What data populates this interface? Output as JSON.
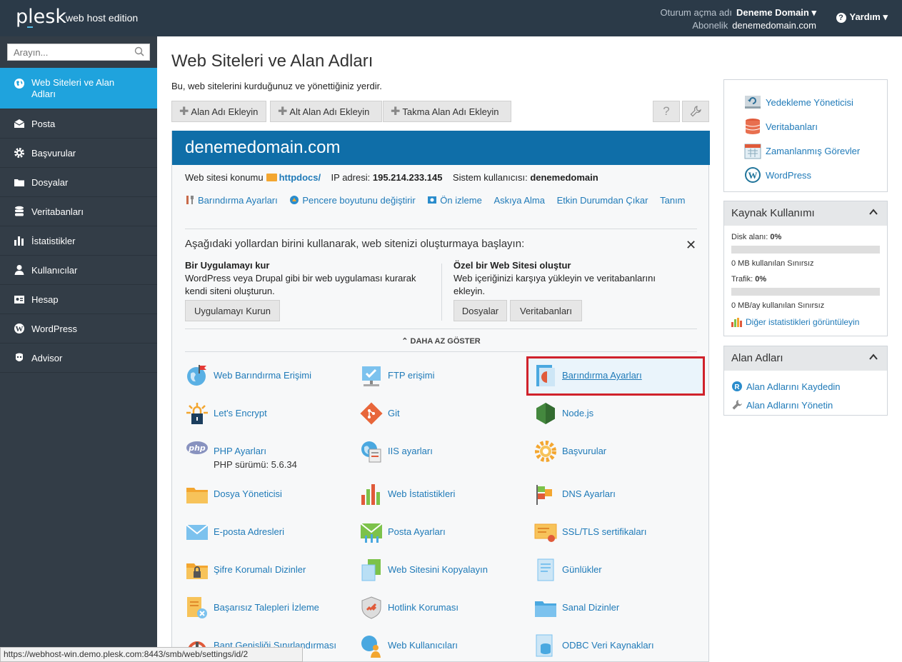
{
  "header": {
    "logo": "plesk",
    "edition": "web host edition",
    "login_label": "Oturum açma adı",
    "login_value": "Deneme Domain",
    "subscription_label": "Abonelik",
    "subscription_value": "denemedomain.com",
    "help": "Yardım"
  },
  "sidebar": {
    "search_placeholder": "Arayın...",
    "items": [
      {
        "label": "Web Siteleri ve Alan Adları",
        "icon": "globe-icon"
      },
      {
        "label": "Posta",
        "icon": "mail-icon"
      },
      {
        "label": "Başvurular",
        "icon": "gear-icon"
      },
      {
        "label": "Dosyalar",
        "icon": "folder-icon"
      },
      {
        "label": "Veritabanları",
        "icon": "database-icon"
      },
      {
        "label": "İstatistikler",
        "icon": "bar-chart-icon"
      },
      {
        "label": "Kullanıcılar",
        "icon": "user-icon"
      },
      {
        "label": "Hesap",
        "icon": "account-icon"
      },
      {
        "label": "WordPress",
        "icon": "wordpress-icon"
      },
      {
        "label": "Advisor",
        "icon": "advisor-icon"
      }
    ]
  },
  "main": {
    "title": "Web Siteleri ve Alan Adları",
    "description": "Bu, web sitelerini kurduğunuz ve yönettiğiniz yerdir.",
    "toolbar": {
      "add_domain": "Alan Adı Ekleyin",
      "add_subdomain": "Alt Alan Adı Ekleyin",
      "add_alias": "Takma Alan Adı Ekleyin"
    },
    "domain": {
      "name": "denemedomain.com",
      "location_label": "Web sitesi konumu",
      "location_value": "httpdocs/",
      "ip_label": "IP adresi:",
      "ip_value": "195.214.233.145",
      "sysuser_label": "Sistem kullanıcısı:",
      "sysuser_value": "denemedomain",
      "actions": [
        "Barındırma Ayarları",
        "Pencere boyutunu değiştirir",
        "Ön izleme",
        "Askıya Alma",
        "Etkin Durumdan Çıkar",
        "Tanım"
      ]
    },
    "start": {
      "title": "Aşağıdaki yollardan birini kullanarak, web sitenizi oluşturmaya başlayın:",
      "left_heading": "Bir Uygulamayı kur",
      "left_text_1": "WordPress veya Drupal gibi bir web uygulaması kurarak",
      "left_text_2": "kendi siteni oluşturun.",
      "left_button": "Uygulamayı Kurun",
      "right_heading": "Özel bir Web Sitesi oluştur",
      "right_text_1": "Web içeriğinizi karşıya yükleyin ve veritabanlarını",
      "right_text_2": "ekleyin.",
      "files_button": "Dosyalar",
      "db_button": "Veritabanları",
      "show_less": "DAHA AZ GÖSTER"
    },
    "tools": [
      {
        "label": "Web Barındırma Erişimi",
        "icon": "web-hosting-access-icon"
      },
      {
        "label": "FTP erişimi",
        "icon": "ftp-icon"
      },
      {
        "label": "Barındırma Ayarları",
        "icon": "hosting-settings-icon"
      },
      {
        "label": "Let's Encrypt",
        "icon": "lets-encrypt-icon"
      },
      {
        "label": "Git",
        "icon": "git-icon"
      },
      {
        "label": "Node.js",
        "icon": "nodejs-icon"
      },
      {
        "label": "PHP Ayarları",
        "icon": "php-icon",
        "sub": "PHP sürümü: 5.6.34"
      },
      {
        "label": "IIS ayarları",
        "icon": "iis-icon"
      },
      {
        "label": "Başvurular",
        "icon": "applications-icon"
      },
      {
        "label": "Dosya Yöneticisi",
        "icon": "file-manager-icon"
      },
      {
        "label": "Web İstatistikleri",
        "icon": "web-statistics-icon"
      },
      {
        "label": "DNS Ayarları",
        "icon": "dns-icon"
      },
      {
        "label": "E-posta Adresleri",
        "icon": "email-icon"
      },
      {
        "label": "Posta Ayarları",
        "icon": "mail-settings-icon"
      },
      {
        "label": "SSL/TLS sertifikaları",
        "icon": "ssl-icon"
      },
      {
        "label": "Şifre Korumalı Dizinler",
        "icon": "protected-dirs-icon"
      },
      {
        "label": "Web Sitesini Kopyalayın",
        "icon": "copy-site-icon"
      },
      {
        "label": "Günlükler",
        "icon": "logs-icon"
      },
      {
        "label": "Başarısız Talepleri İzleme",
        "icon": "failed-requests-icon"
      },
      {
        "label": "Hotlink Koruması",
        "icon": "hotlink-icon"
      },
      {
        "label": "Sanal Dizinler",
        "icon": "virtual-dirs-icon"
      },
      {
        "label": "Bant Genişliği Sınırlandırması",
        "icon": "bandwidth-icon"
      },
      {
        "label": "Web Kullanıcıları",
        "icon": "web-users-icon"
      },
      {
        "label": "ODBC Veri Kaynakları",
        "icon": "odbc-icon"
      }
    ]
  },
  "right": {
    "links": [
      {
        "label": "Yedekleme Yöneticisi",
        "icon": "backup-icon"
      },
      {
        "label": "Veritabanları",
        "icon": "database-icon"
      },
      {
        "label": "Zamanlanmış Görevler",
        "icon": "calendar-icon"
      },
      {
        "label": "WordPress",
        "icon": "wordpress-icon"
      }
    ],
    "usage": {
      "title": "Kaynak Kullanımı",
      "disk_label": "Disk alanı:",
      "disk_value": "0%",
      "disk_fraction": 0,
      "disk_detail": "0 MB kullanılan Sınırsız",
      "traffic_label": "Trafik:",
      "traffic_value": "0%",
      "traffic_fraction": 0,
      "traffic_detail": "0 MB/ay kullanılan Sınırsız",
      "more_stats": "Diğer istatistikleri görüntüleyin"
    },
    "domains": {
      "title": "Alan Adları",
      "register": "Alan Adlarını Kaydedin",
      "manage": "Alan Adlarını Yönetin"
    }
  },
  "status_url": "https://webhost-win.demo.plesk.com:8443/smb/web/settings/id/2",
  "colors": {
    "sidebar": "#333d47",
    "topbar": "#2b3a48",
    "active": "#1fa3dd",
    "domain_header": "#0f6ea8",
    "link": "#1f7ab8",
    "highlight": "#d0222b"
  }
}
